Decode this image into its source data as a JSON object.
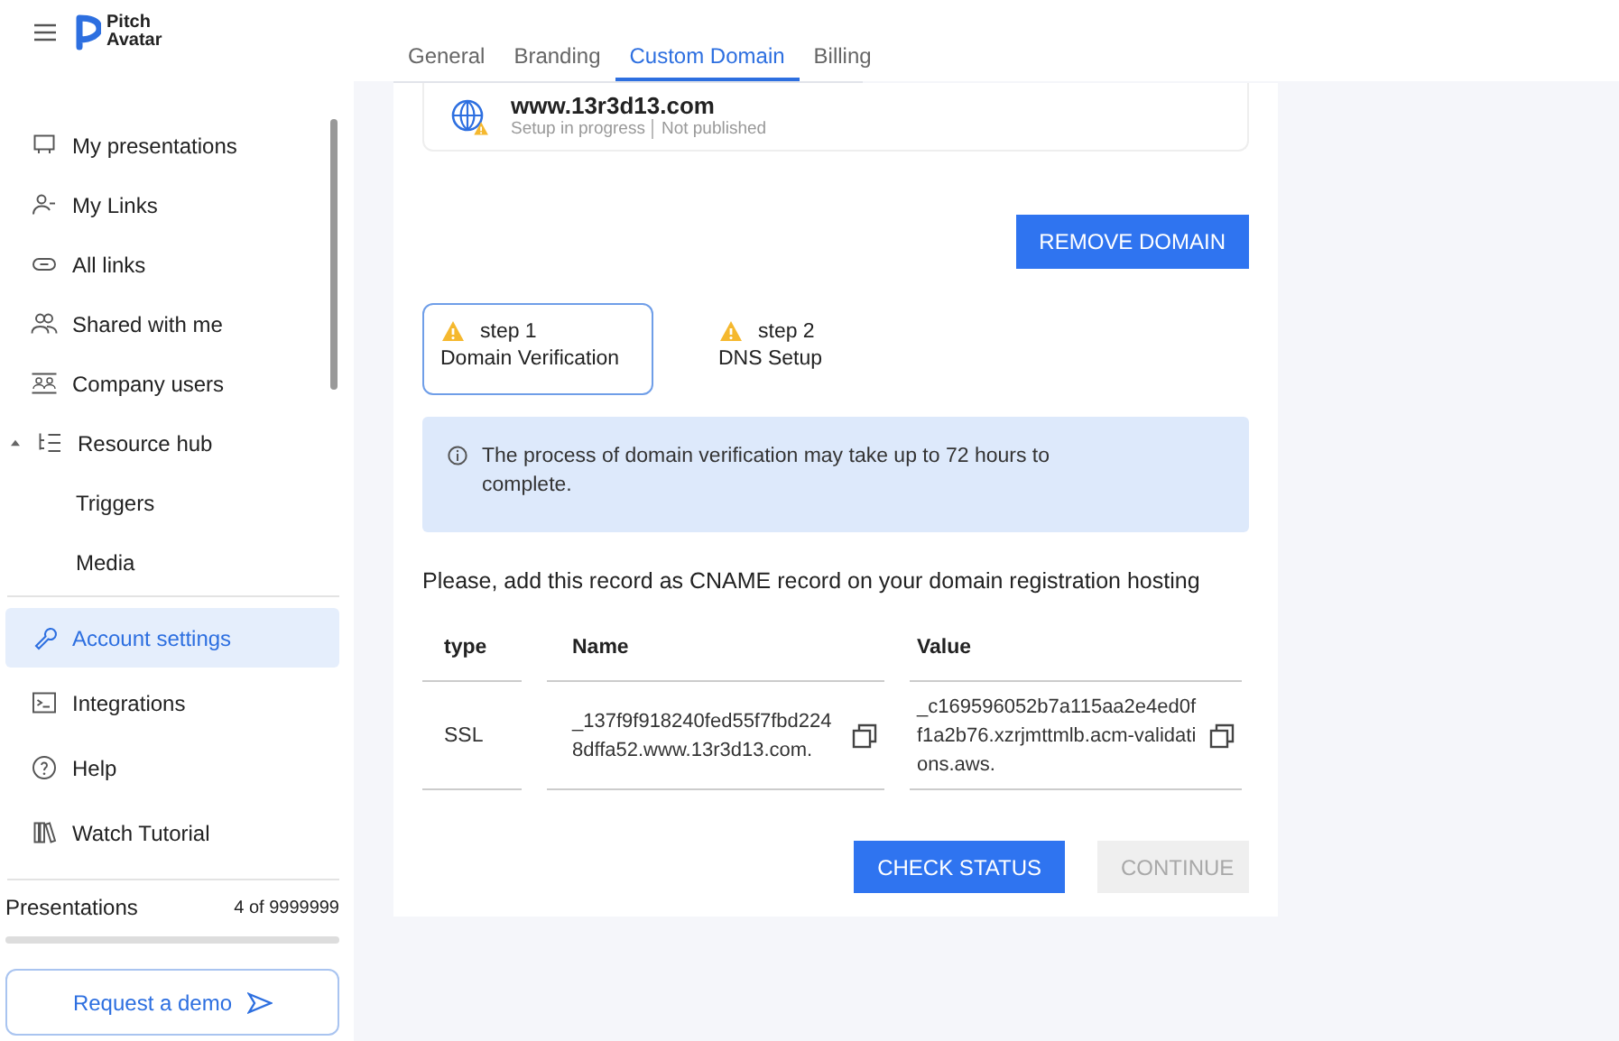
{
  "header": {
    "logo_line1": "Pitch",
    "logo_line2": "Avatar"
  },
  "sidebar": {
    "items": [
      {
        "label": "My presentations",
        "selected": false
      },
      {
        "label": "My Links",
        "selected": false
      },
      {
        "label": "All links",
        "selected": false
      },
      {
        "label": "Shared with me",
        "selected": false
      },
      {
        "label": "Company users",
        "selected": false
      },
      {
        "label": "Resource hub",
        "selected": false,
        "expanded": true,
        "children": [
          {
            "label": "Triggers",
            "selected": false
          },
          {
            "label": "Media",
            "selected": false
          }
        ]
      }
    ],
    "bottom_items": [
      {
        "label": "Account settings",
        "selected": true
      },
      {
        "label": "Integrations",
        "selected": false
      },
      {
        "label": "Help",
        "selected": false
      },
      {
        "label": "Watch Tutorial",
        "selected": false
      }
    ],
    "usage": {
      "label": "Presentations",
      "count": "4 of 9999999",
      "level": 0
    },
    "demo_button": "Request a demo"
  },
  "tabs": [
    {
      "label": "General",
      "selected": false
    },
    {
      "label": "Branding",
      "selected": false
    },
    {
      "label": "Custom Domain",
      "selected": true
    },
    {
      "label": "Billing",
      "selected": false
    }
  ],
  "domain": {
    "name": "www.13r3d13.com",
    "status": "Setup in progress",
    "publish_state": "Not published"
  },
  "remove_button": "REMOVE DOMAIN",
  "steps": [
    {
      "number": "step 1",
      "title": "Domain Verification",
      "selected": true
    },
    {
      "number": "step 2",
      "title": "DNS Setup",
      "selected": false
    }
  ],
  "info": "The process of domain verification may take up to 72 hours to complete.",
  "instruction": "Please, add this record as CNAME record on your domain registration hosting",
  "table": {
    "columns": [
      "type",
      "Name",
      "Value"
    ],
    "rows": [
      {
        "type": "SSL",
        "name": "_137f9f918240fed55f7fbd2248dffa52.www.13r3d13.com.",
        "value": "_c169596052b7a115aa2e4ed0ff1a2b76.xzrjmttmlb.acm-validations.aws."
      }
    ]
  },
  "actions": [
    {
      "label": "CHECK STATUS",
      "disabled": false
    },
    {
      "label": "CONTINUE",
      "disabled": true
    }
  ]
}
